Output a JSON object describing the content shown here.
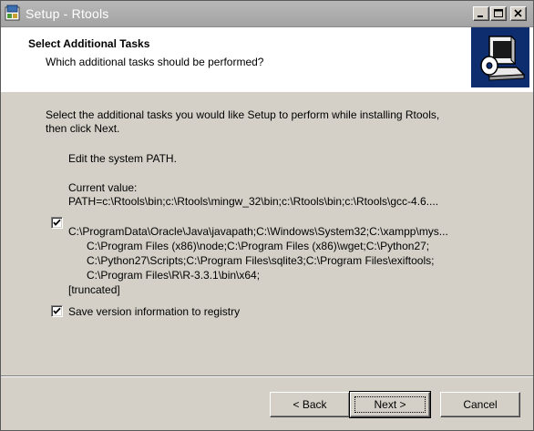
{
  "window": {
    "title": "Setup - Rtools",
    "controls": {
      "minimize": "minimize",
      "maximize": "maximize",
      "close": "close"
    }
  },
  "header": {
    "title": "Select Additional Tasks",
    "subtitle": "Which additional tasks should be performed?"
  },
  "body": {
    "intro_line1": "Select the additional tasks you would like Setup to perform while installing Rtools,",
    "intro_line2": "then click Next.",
    "edit_path_label": "Edit the system PATH.",
    "current_value_label": "Current value:",
    "current_value": "PATH=c:\\Rtools\\bin;c:\\Rtools\\mingw_32\\bin;c:\\Rtools\\bin;c:\\Rtools\\gcc-4.6....",
    "path_task": {
      "checked": true,
      "line1": "C:\\ProgramData\\Oracle\\Java\\javapath;C:\\Windows\\System32;C:\\xampp\\mys...",
      "line2": "C:\\Program Files (x86)\\node;C:\\Program Files (x86)\\wget;C:\\Python27;",
      "line3": "C:\\Python27\\Scripts;C:\\Program Files\\sqlite3;C:\\Program Files\\exiftools;",
      "line4": "C:\\Program Files\\R\\R-3.3.1\\bin\\x64;",
      "line5": "[truncated]"
    },
    "registry_task": {
      "checked": true,
      "label": "Save version information to registry"
    }
  },
  "buttons": {
    "back": "< Back",
    "next": "Next >",
    "cancel": "Cancel"
  },
  "colors": {
    "dialog_bg": "#d4d0c8",
    "titlebar": "#a8a8a8",
    "logo_bg": "#0d2d6e"
  }
}
